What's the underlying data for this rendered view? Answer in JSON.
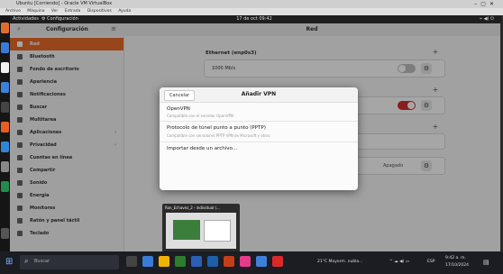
{
  "vbox": {
    "title": "Ubuntu [Corriendo] - Oracle VM VirtualBox",
    "menu": [
      "Archivo",
      "Máquina",
      "Ver",
      "Entrada",
      "Dispositivos",
      "Ayuda"
    ]
  },
  "gnome_top": {
    "activities": "Actividades",
    "app": "Configuración",
    "clock": "17 de oct 09:42"
  },
  "settings": {
    "sidebar_title": "Configuración",
    "page_title": "Red",
    "sidebar_items": [
      {
        "label": "Red",
        "icon": "network-icon",
        "selected": true
      },
      {
        "label": "Bluetooth",
        "icon": "bluetooth-icon"
      },
      {
        "label": "Fondo de escritorio",
        "icon": "background-icon"
      },
      {
        "label": "Apariencia",
        "icon": "appearance-icon"
      },
      {
        "label": "Notificaciones",
        "icon": "bell-icon"
      },
      {
        "label": "Buscar",
        "icon": "search-icon"
      },
      {
        "label": "Multitarea",
        "icon": "multitask-icon"
      },
      {
        "label": "Aplicaciones",
        "icon": "apps-icon",
        "chevron": "›"
      },
      {
        "label": "Privacidad",
        "icon": "lock-icon",
        "chevron": "›"
      },
      {
        "label": "Cuentas en línea",
        "icon": "cloud-icon"
      },
      {
        "label": "Compartir",
        "icon": "share-icon"
      },
      {
        "label": "Sonido",
        "icon": "music-icon"
      },
      {
        "label": "Energía",
        "icon": "power-icon"
      },
      {
        "label": "Monitores",
        "icon": "display-icon"
      },
      {
        "label": "Ratón y panel táctil",
        "icon": "mouse-icon"
      },
      {
        "label": "Teclado",
        "icon": "keyboard-icon"
      }
    ],
    "ethernet": {
      "title": "Ethernet (enp0s3)",
      "speed": "1000 Mb/s",
      "toggle_on": false
    },
    "vpn_row": {
      "toggle_on": true
    },
    "proxy": {
      "state": "Apagado"
    }
  },
  "dialog": {
    "cancel": "Cancelar",
    "title": "Añadir VPN",
    "options": [
      {
        "name": "OpenVPN",
        "desc": "Compatible con el servidor OpenVPN"
      },
      {
        "name": "Protocolo de túnel punto a punto (PPTP)",
        "desc": "Compatible con servidores PPTP VPN de Microsoft y otros"
      },
      {
        "name": "Importar desde un archivo…",
        "desc": ""
      }
    ]
  },
  "thumbnail": {
    "caption": "Ron_Echavez_2 - individual (..."
  },
  "taskbar": {
    "search_placeholder": "Buscar",
    "weather": "21°C Mayorm. nubla...",
    "lang": "ESP",
    "time": "9:42 a. m.",
    "date": "17/10/2024"
  },
  "colors": {
    "accent": "#e86b2a",
    "toggle_on": "#d32f2f",
    "toggle_off": "#bfbfbf"
  }
}
